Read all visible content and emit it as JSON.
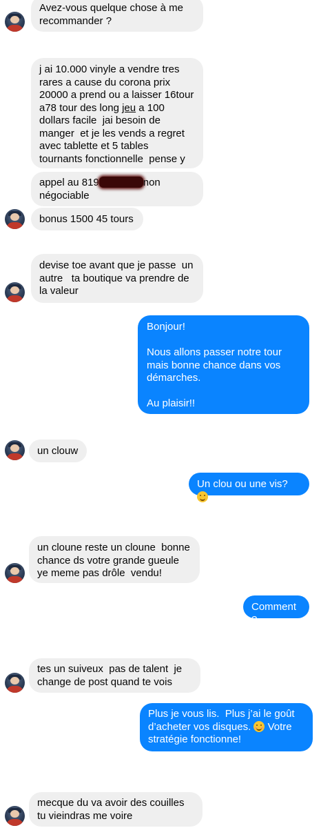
{
  "messages": [
    {
      "text": "Avez-vous quelque chose à me\nrecommander ?"
    },
    {
      "text_before": "j ai 10.000 vinyle a vendre tres\nrares a cause du corona prix\n20000 a prend ou a laisser 16tour\na78 tour des long ",
      "underlined": "jeu",
      "text_after": " a 100\ndollars facile  jai besoin de\nmanger  et je les vends a regret\navec tablette et 5 tables\ntournants fonctionnelle  pense y"
    },
    {
      "text_before": "appel au 819",
      "text_after": "non\nnégociable"
    },
    {
      "text": "bonus 1500 45 tours"
    },
    {
      "text": "devise toe avant que je passe  un\nautre   ta boutique va prendre de\nla valeur"
    },
    {
      "text": "Bonjour!\n\nNous allons passer notre tour\nmais bonne chance dans vos\ndémarches.\n\nAu plaisir!!"
    },
    {
      "text": "un clouw"
    },
    {
      "text": "Un clou ou une vis?",
      "emoji": "slightly-smiling-face-icon"
    },
    {
      "text": "un cloune reste un cloune  bonne\nchance ds votre grande gueule\nye meme pas drôle  vendu!"
    },
    {
      "text": "Comment?"
    },
    {
      "text": "tes un suiveux  pas de talent  je\nchange de post quand te vois"
    },
    {
      "text_before": "Plus je vous lis.  Plus j’ai le goût\nd’acheter vos disques. ",
      "text_after": " Votre\nstratégie fonctionne!",
      "emoji": "smiling-face-with-blush-icon"
    },
    {
      "text": "mecque du va avoir des couilles\ntu vieindras me voire"
    }
  ],
  "colors": {
    "incoming_bubble": "#efefef",
    "outgoing_bubble": "#0a84ff",
    "outgoing_text": "#ffffff"
  }
}
